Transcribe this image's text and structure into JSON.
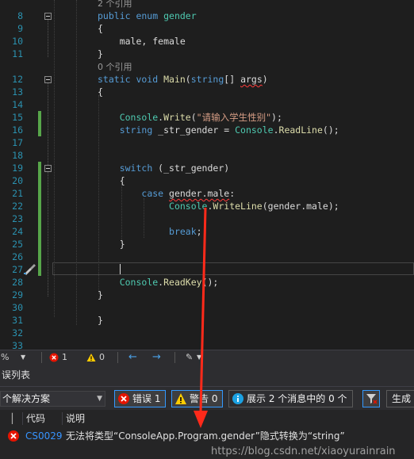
{
  "editor": {
    "lines": [
      {
        "num": "",
        "tokens": [
          {
            "t": "2 个引用",
            "c": "ref"
          }
        ]
      },
      {
        "num": "8",
        "tokens": [
          {
            "t": "public enum ",
            "c": "kw"
          },
          {
            "t": "gender",
            "c": "ty"
          }
        ]
      },
      {
        "num": "9",
        "tokens": [
          {
            "t": "{",
            "c": ""
          }
        ]
      },
      {
        "num": "10",
        "tokens": [
          {
            "t": "    male, female",
            "c": ""
          }
        ]
      },
      {
        "num": "11",
        "tokens": [
          {
            "t": "}",
            "c": ""
          }
        ]
      },
      {
        "num": "",
        "tokens": [
          {
            "t": "0 个引用",
            "c": "ref"
          }
        ]
      },
      {
        "num": "12",
        "tokens": [
          {
            "t": "static void ",
            "c": "kw"
          },
          {
            "t": "Main",
            "c": "fn"
          },
          {
            "t": "(",
            "c": ""
          },
          {
            "t": "string",
            "c": "kw"
          },
          {
            "t": "[] ",
            "c": ""
          },
          {
            "t": "args",
            "c": "err"
          },
          {
            "t": ")",
            "c": ""
          }
        ]
      },
      {
        "num": "13",
        "tokens": [
          {
            "t": "{",
            "c": ""
          }
        ]
      },
      {
        "num": "14",
        "tokens": []
      },
      {
        "num": "15",
        "tokens": [
          {
            "t": "    ",
            "c": ""
          },
          {
            "t": "Console",
            "c": "ty"
          },
          {
            "t": ".",
            "c": ""
          },
          {
            "t": "Write",
            "c": "fn"
          },
          {
            "t": "(",
            "c": ""
          },
          {
            "t": "\"请输入学生性别\"",
            "c": "str"
          },
          {
            "t": ");",
            "c": ""
          }
        ]
      },
      {
        "num": "16",
        "tokens": [
          {
            "t": "    ",
            "c": ""
          },
          {
            "t": "string",
            "c": "kw"
          },
          {
            "t": " _str_gender = ",
            "c": ""
          },
          {
            "t": "Console",
            "c": "ty"
          },
          {
            "t": ".",
            "c": ""
          },
          {
            "t": "ReadLine",
            "c": "fn"
          },
          {
            "t": "();",
            "c": ""
          }
        ]
      },
      {
        "num": "17",
        "tokens": []
      },
      {
        "num": "18",
        "tokens": []
      },
      {
        "num": "19",
        "tokens": [
          {
            "t": "    ",
            "c": ""
          },
          {
            "t": "switch",
            "c": "kw"
          },
          {
            "t": " (_str_gender)",
            "c": ""
          }
        ]
      },
      {
        "num": "20",
        "tokens": [
          {
            "t": "    {",
            "c": ""
          }
        ]
      },
      {
        "num": "21",
        "tokens": [
          {
            "t": "        ",
            "c": ""
          },
          {
            "t": "case",
            "c": "kw"
          },
          {
            "t": " ",
            "c": ""
          },
          {
            "t": "gender.male",
            "c": "err"
          },
          {
            "t": ":",
            "c": ""
          }
        ]
      },
      {
        "num": "22",
        "tokens": [
          {
            "t": "             ",
            "c": ""
          },
          {
            "t": "Console",
            "c": "ty"
          },
          {
            "t": ".",
            "c": ""
          },
          {
            "t": "WriteLine",
            "c": "fn"
          },
          {
            "t": "(gender.male);",
            "c": ""
          }
        ]
      },
      {
        "num": "23",
        "tokens": []
      },
      {
        "num": "24",
        "tokens": [
          {
            "t": "             ",
            "c": ""
          },
          {
            "t": "break",
            "c": "kw"
          },
          {
            "t": ";",
            "c": ""
          }
        ]
      },
      {
        "num": "25",
        "tokens": [
          {
            "t": "    }",
            "c": ""
          }
        ]
      },
      {
        "num": "26",
        "tokens": []
      },
      {
        "num": "27",
        "tokens": []
      },
      {
        "num": "28",
        "tokens": [
          {
            "t": "    ",
            "c": ""
          },
          {
            "t": "Console",
            "c": "ty"
          },
          {
            "t": ".",
            "c": ""
          },
          {
            "t": "ReadKey",
            "c": "fn"
          },
          {
            "t": "();",
            "c": ""
          }
        ]
      },
      {
        "num": "29",
        "tokens": [
          {
            "t": "}",
            "c": ""
          }
        ]
      },
      {
        "num": "30",
        "tokens": []
      },
      {
        "num": "31",
        "tokens": [
          {
            "t": "}",
            "c": ""
          }
        ]
      },
      {
        "num": "32",
        "tokens": []
      },
      {
        "num": "33",
        "tokens": []
      }
    ]
  },
  "editbar": {
    "zoom": "%",
    "errors": "1",
    "warnings": "0"
  },
  "error_list": {
    "title": "误列表",
    "scope": "个解决方案",
    "errors_btn": "错误 1",
    "warnings_btn": "警告 0",
    "messages_btn": "展示 2 个消息中的 0 个",
    "build_btn": "生成",
    "col_code": "代码",
    "col_desc": "说明",
    "row": {
      "code": "CS0029",
      "description": "无法将类型“ConsoleApp.Program.gender”隐式转换为“string”"
    },
    "watermark": "https://blog.csdn.net/xiaoyurainrain"
  },
  "colors": {
    "error_red": "#e51400",
    "warning_yellow": "#ffcc00",
    "info_blue": "#1ba1e2",
    "arrow_red": "#ff2a1a"
  }
}
